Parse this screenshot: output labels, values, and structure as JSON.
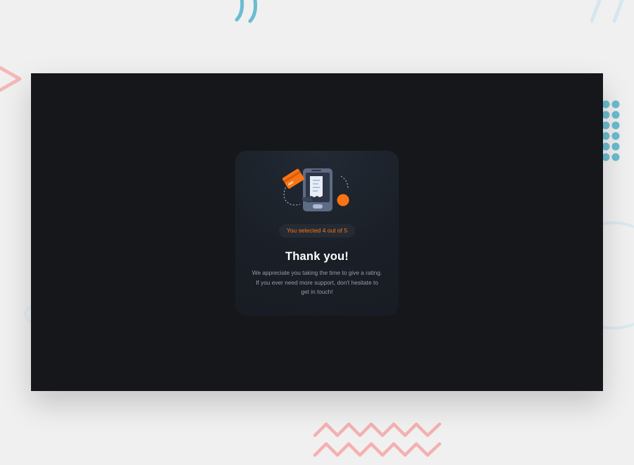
{
  "colors": {
    "background": "#f0f0f0",
    "screen": "#15171b",
    "card": "#1e242d",
    "accent": "#fb7413",
    "heading": "#ffffff",
    "body_text": "#959eac",
    "deco_blue": "#6bbcd0",
    "deco_pink": "#f5a6a6"
  },
  "icons": {
    "illustration": "phone-payment-illustration",
    "decorations": [
      "arcs-decoration",
      "chevron-decoration",
      "dots-grid-decoration",
      "zigzag-decoration",
      "ring-decoration"
    ]
  },
  "card": {
    "selection_text": "You selected 4 out of 5",
    "rating": {
      "selected": 4,
      "max": 5
    },
    "title": "Thank you!",
    "message_lines": [
      "We appreciate you taking the time to give a rating.",
      "If you ever need more support, don't hesitate to",
      "get in touch!"
    ]
  }
}
